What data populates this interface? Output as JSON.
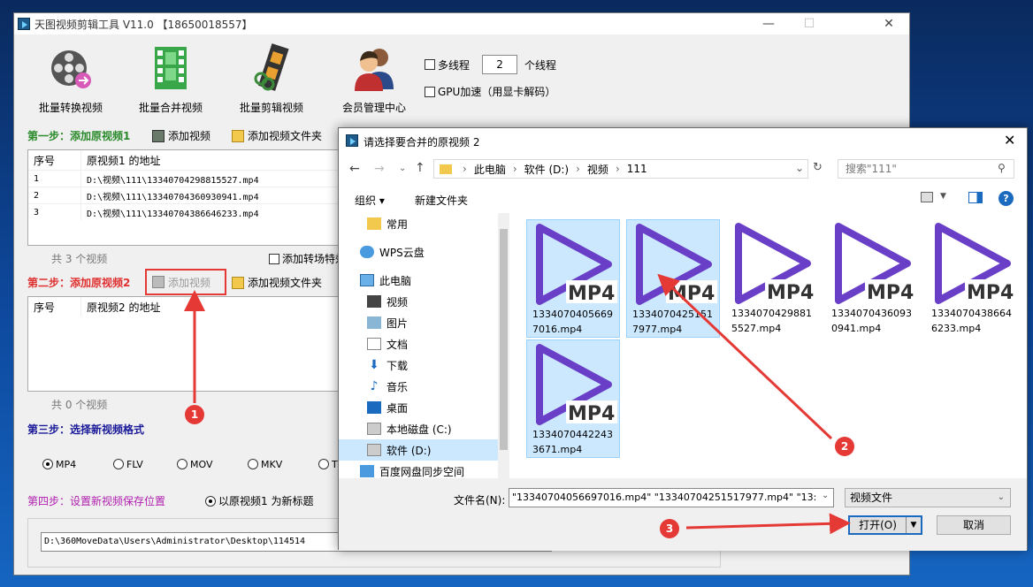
{
  "main": {
    "title": "天图视频剪辑工具 V11.0 【18650018557】",
    "tools": [
      {
        "label": "批量转换视频"
      },
      {
        "label": "批量合并视频"
      },
      {
        "label": "批量剪辑视频"
      },
      {
        "label": "会员管理中心"
      }
    ],
    "multithread_label": "多线程",
    "thread_count": "2",
    "thread_unit": "个线程",
    "gpu_label": "GPU加速（用显卡解码）",
    "step1": {
      "label": "第一步：添加原视频1",
      "add_video": "添加视频",
      "add_folder": "添加视频文件夹"
    },
    "list1": {
      "col_index": "序号",
      "col_path": "原视频1 的地址",
      "rows": [
        {
          "idx": "1",
          "path": "D:\\视频\\111\\13340704298815527.mp4"
        },
        {
          "idx": "2",
          "path": "D:\\视频\\111\\13340704360930941.mp4"
        },
        {
          "idx": "3",
          "path": "D:\\视频\\111\\13340704386646233.mp4"
        }
      ],
      "count": "共 3 个视频"
    },
    "transition_label": "添加转场特效",
    "step2": {
      "label": "第二步：添加原视频2",
      "add_video": "添加视频",
      "add_folder": "添加视频文件夹"
    },
    "list2": {
      "col_index": "序号",
      "col_path": "原视频2 的地址",
      "count": "共 0 个视频"
    },
    "step3": {
      "label": "第三步：选择新视频格式"
    },
    "formats": [
      "MP4",
      "FLV",
      "MOV",
      "MKV",
      "TS"
    ],
    "selected_format": "MP4",
    "step4": {
      "label": "第四步：设置新视频保存位置",
      "title_option": "以原视频1 为新标题"
    },
    "save_path": "D:\\360MoveData\\Users\\Administrator\\Desktop\\114514"
  },
  "dialog": {
    "title": "请选择要合并的原视频 2",
    "breadcrumb": [
      "此电脑",
      "软件 (D:)",
      "视频",
      "111"
    ],
    "search_placeholder": "搜索\"111\"",
    "organize": "组织 ▾",
    "new_folder": "新建文件夹",
    "nav": [
      {
        "label": "常用"
      },
      {
        "label": "WPS云盘"
      },
      {
        "label": "此电脑"
      },
      {
        "label": "视频"
      },
      {
        "label": "图片"
      },
      {
        "label": "文档"
      },
      {
        "label": "下载"
      },
      {
        "label": "音乐"
      },
      {
        "label": "桌面"
      },
      {
        "label": "本地磁盘 (C:)"
      },
      {
        "label": "软件 (D:)"
      },
      {
        "label": "百度网盘同步空间"
      }
    ],
    "files": [
      {
        "name": "13340704056697016.mp4",
        "selected": true
      },
      {
        "name": "13340704251517977.mp4",
        "selected": true
      },
      {
        "name": "13340704298815527.mp4",
        "selected": false
      },
      {
        "name": "13340704360930941.mp4",
        "selected": false
      },
      {
        "name": "13340704386646233.mp4",
        "selected": false
      },
      {
        "name": "13340704422433671.mp4",
        "selected": true
      }
    ],
    "file_badge": "MP4",
    "filename_label": "文件名(N):",
    "filename_value": "\"13340704056697016.mp4\" \"13340704251517977.mp4\" \"13:",
    "filetype_value": "视频文件",
    "open_button": "打开(O)",
    "cancel_button": "取消"
  },
  "annotations": [
    "1",
    "2",
    "3"
  ],
  "colors": {
    "step1": "#2a8a2a",
    "step2": "#e03030",
    "step3": "#1a1a9a",
    "step4": "#b020b0",
    "annotation": "#e53935",
    "play_icon": "#6a3fc8",
    "selection": "#cce8ff"
  }
}
